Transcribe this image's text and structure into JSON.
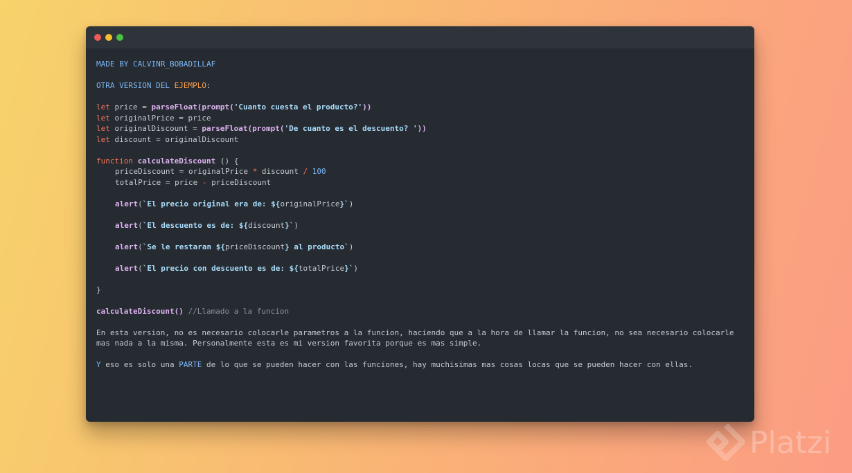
{
  "colors": {
    "red_dot": "#ee5b59",
    "yellow_dot": "#f4be2f",
    "green_dot": "#4bc23f"
  },
  "header": {
    "made_by": "MADE BY CALVINR_BOBADILLAF",
    "otra_version": "OTRA VERSION DEL ",
    "ejemplo": "EJEMPLO",
    "colon": ":"
  },
  "code": {
    "let": "let",
    "l1_a": " price = ",
    "l1_fn": "parseFloat(prompt(",
    "l1_str": "'Cuanto cuesta el producto?'",
    "l1_end": "))",
    "l2_a": " originalPrice = price",
    "l3_a": " originalDiscount = ",
    "l3_fn": "parseFloat(prompt(",
    "l3_str": "'De cuanto es el descuento? '",
    "l3_end": "))",
    "l4_a": " discount = originalDiscount",
    "function_kw": "function",
    "fn_name": " calculateDiscount",
    "fn_sig": " () {",
    "b1_a": "priceDiscount = originalPrice ",
    "b1_mul": "*",
    "b1_b": " discount ",
    "b1_div": "/",
    "b1_num": " 100",
    "b2_a": "totalPrice = price ",
    "b2_minus": "-",
    "b2_b": " priceDiscount",
    "alert": "alert",
    "paren_open": "(",
    "paren_close": ")",
    "a1_s1": "`El precio original era de: ${",
    "a1_v": "originalPrice",
    "a1_s2": "}`",
    "a2_s1": "`El descuento es de: ${",
    "a2_v": "discount",
    "a2_s2": "}`",
    "a3_s1": "`Se le restaran ${",
    "a3_v": "priceDiscount",
    "a3_s2": "} al producto`",
    "a4_s1": "`El precio con descuento es de: ${",
    "a4_v": "totalPrice",
    "a4_s2": "}`",
    "close_brace": "}",
    "call": "calculateDiscount()",
    "comment": " //Llamado a la funcion"
  },
  "prose": {
    "p1_l1": "En esta version, no es necesario colocarle parametros a la funcion, haciendo que a la hora de llamar la funcion, no sea necesario colocarle",
    "p1_l2": "mas nada a la misma. Personalmente esta es mi version favorita porque es mas simple.",
    "p2_y": "Y",
    "p2_a": " eso es solo una ",
    "p2_parte": "PARTE",
    "p2_b": " de lo que se pueden hacer con las funciones, hay muchisimas mas cosas locas que se pueden hacer con ellas."
  },
  "watermark": {
    "text": "Platzi",
    "icon": "platzi-logo-icon"
  }
}
